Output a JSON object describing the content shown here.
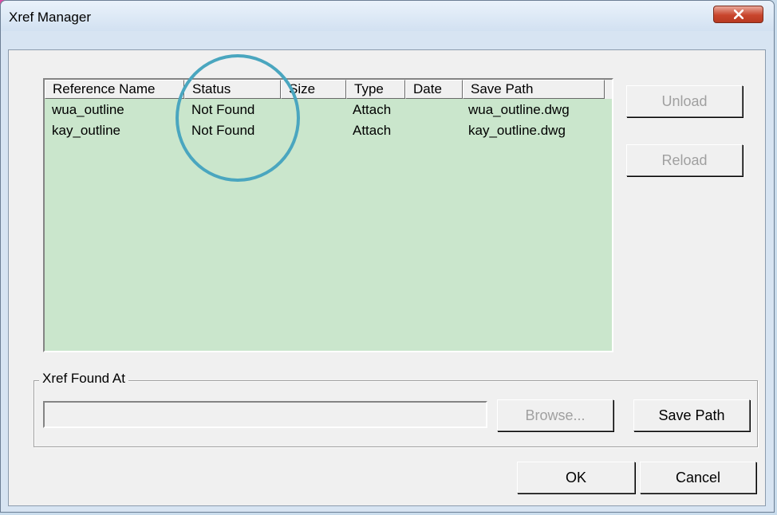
{
  "window": {
    "title": "Xref Manager",
    "close_glyph": "✕"
  },
  "list": {
    "columns": [
      "Reference Name",
      "Status",
      "Size",
      "Type",
      "Date",
      "Save Path"
    ],
    "rows": [
      {
        "reference_name": "wua_outline",
        "status": "Not Found",
        "size": "",
        "type": "Attach",
        "date": "",
        "save_path": "wua_outline.dwg"
      },
      {
        "reference_name": "kay_outline",
        "status": "Not Found",
        "size": "",
        "type": "Attach",
        "date": "",
        "save_path": "kay_outline.dwg"
      }
    ],
    "background_color": "#cae6cc"
  },
  "buttons": {
    "unload": "Unload",
    "reload": "Reload",
    "browse": "Browse...",
    "save_path": "Save Path",
    "ok": "OK",
    "cancel": "Cancel"
  },
  "found_at": {
    "group_label": "Xref Found At",
    "value": ""
  },
  "annotation": {
    "circle_color": "#4aa6bf"
  }
}
